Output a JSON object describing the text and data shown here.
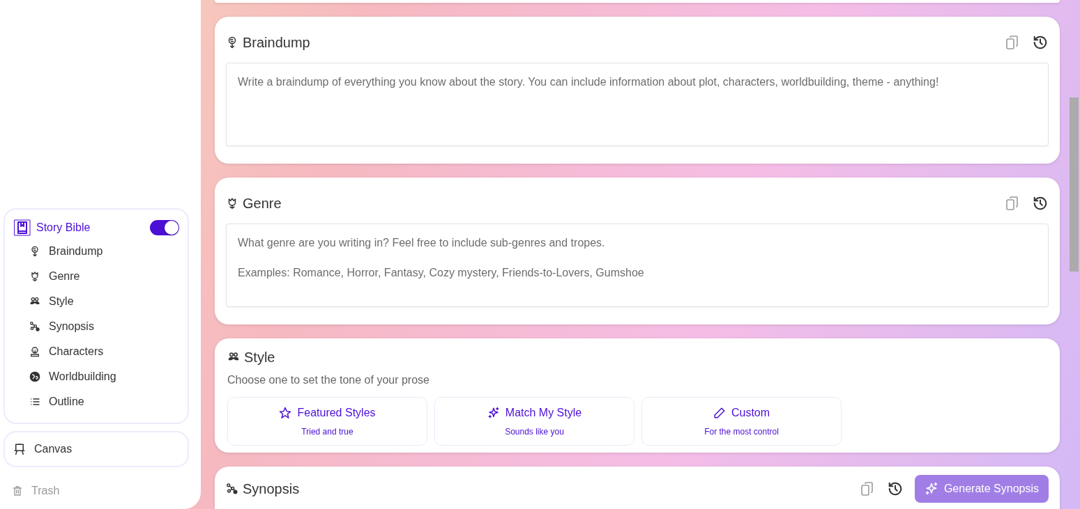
{
  "sidebar": {
    "story_bible": {
      "label": "Story Bible",
      "on": true
    },
    "items": [
      {
        "label": "Braindump"
      },
      {
        "label": "Genre"
      },
      {
        "label": "Style"
      },
      {
        "label": "Synopsis"
      },
      {
        "label": "Characters"
      },
      {
        "label": "Worldbuilding"
      },
      {
        "label": "Outline"
      }
    ],
    "canvas": {
      "label": "Canvas"
    },
    "trash": {
      "label": "Trash"
    }
  },
  "sections": [
    {
      "kind": "text",
      "title": "Braindump",
      "placeholder": "Write a braindump of everything you know about the story. You can include information about plot, characters, worldbuilding, theme - anything!"
    },
    {
      "kind": "text",
      "title": "Genre",
      "placeholder": "What genre are you writing in? Feel free to include sub-genres and tropes.\n\nExamples: Romance, Horror, Fantasy, Cozy mystery, Friends-to-Lovers, Gumshoe"
    },
    {
      "kind": "options",
      "title": "Style",
      "subtitle": "Choose one to set the tone of your prose",
      "options": [
        {
          "label": "Featured Styles",
          "caption": "Tried and true"
        },
        {
          "label": "Match My Style",
          "caption": "Sounds like you"
        },
        {
          "label": "Custom",
          "caption": "For the most control"
        }
      ]
    },
    {
      "kind": "generate",
      "title": "Synopsis",
      "button": {
        "label": "Generate Synopsis",
        "disabled": true
      }
    }
  ]
}
